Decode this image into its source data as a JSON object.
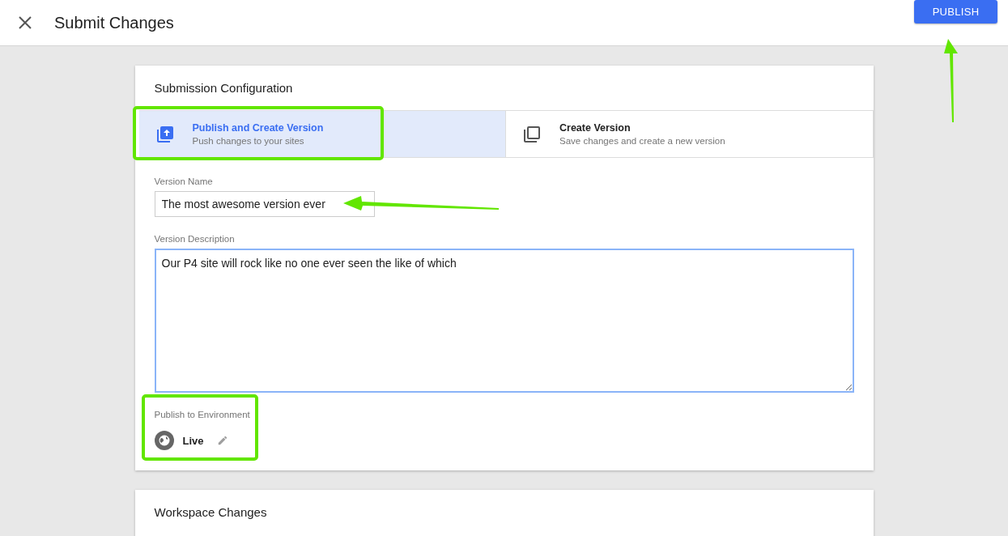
{
  "header": {
    "title": "Submit Changes",
    "publish_button": "PUBLISH"
  },
  "submission_configuration": {
    "title": "Submission Configuration",
    "options": [
      {
        "kind": "publish",
        "title": "Publish and Create Version",
        "subtitle": "Push changes to your sites",
        "selected": true
      },
      {
        "kind": "version",
        "title": "Create Version",
        "subtitle": "Save changes and create a new version",
        "selected": false
      }
    ],
    "version_name": {
      "label": "Version Name",
      "value": "The most awesome version ever"
    },
    "version_description": {
      "label": "Version Description",
      "value": "Our P4 site will rock like no one ever seen the like of which "
    },
    "environment": {
      "label": "Publish to Environment",
      "name": "Live"
    }
  },
  "workspace_changes": {
    "title": "Workspace Changes"
  }
}
